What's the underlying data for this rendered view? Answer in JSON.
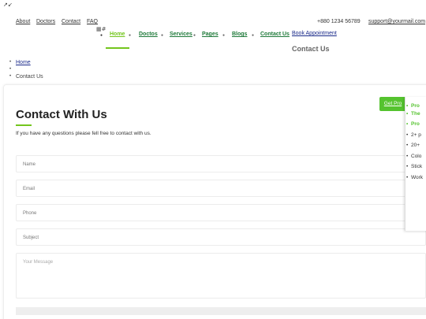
{
  "corner_glyph": "↗↙",
  "topbar": {
    "links": [
      "About",
      "Doctors",
      "Contact",
      "FAQ"
    ],
    "phone": "+880 1234 56789",
    "email": "support@yourmail.com"
  },
  "brand": {
    "image_alt": "#"
  },
  "nav": {
    "items": [
      {
        "label": "Home"
      },
      {
        "label": "Doctos"
      },
      {
        "label": "Services"
      },
      {
        "label": "Pages"
      },
      {
        "label": "Blogs"
      },
      {
        "label": "Contact Us"
      }
    ],
    "active_color": "#73c51d",
    "link_color": "#1f7a3a"
  },
  "appointment": "Book Appointment",
  "page_title": "Contact Us",
  "breadcrumbs": {
    "home": "Home",
    "empty": "",
    "current": "Contact Us"
  },
  "form": {
    "title": "Contact With Us",
    "description": "If you have any questions please fell free to contact with us.",
    "fields": {
      "name": "Name",
      "email": "Email",
      "phone": "Phone",
      "subject": "Subject",
      "message": "Your Message"
    },
    "submit": ""
  },
  "pro": {
    "button": "Get Pro",
    "accent": "#55c32f",
    "items": [
      {
        "text": "Pro",
        "green": true
      },
      {
        "text": "The",
        "green": true
      },
      {
        "text": "Pro",
        "green": true
      },
      {
        "text": "2+ p",
        "green": false
      },
      {
        "text": "20+",
        "green": false
      },
      {
        "text": "Colo",
        "green": false
      },
      {
        "text": "Stick",
        "green": false
      },
      {
        "text": "Work",
        "green": false
      }
    ]
  }
}
